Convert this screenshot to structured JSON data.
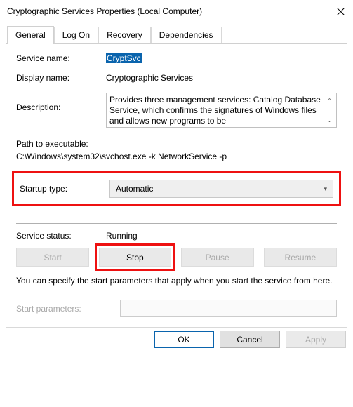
{
  "titlebar": {
    "title": "Cryptographic Services Properties (Local Computer)"
  },
  "tabs": {
    "general": "General",
    "logon": "Log On",
    "recovery": "Recovery",
    "dependencies": "Dependencies"
  },
  "labels": {
    "service_name": "Service name:",
    "display_name": "Display name:",
    "description": "Description:",
    "path_label": "Path to executable:",
    "startup_type": "Startup type:",
    "service_status": "Service status:",
    "start_parameters": "Start parameters:"
  },
  "values": {
    "service_name": "CryptSvc",
    "display_name": "Cryptographic Services",
    "description": "Provides three management services: Catalog Database Service, which confirms the signatures of Windows files and allows new programs to be",
    "path": "C:\\Windows\\system32\\svchost.exe -k NetworkService -p",
    "startup_type": "Automatic",
    "service_status": "Running",
    "start_parameters": ""
  },
  "buttons": {
    "start": "Start",
    "stop": "Stop",
    "pause": "Pause",
    "resume": "Resume",
    "ok": "OK",
    "cancel": "Cancel",
    "apply": "Apply"
  },
  "note": "You can specify the start parameters that apply when you start the service from here."
}
